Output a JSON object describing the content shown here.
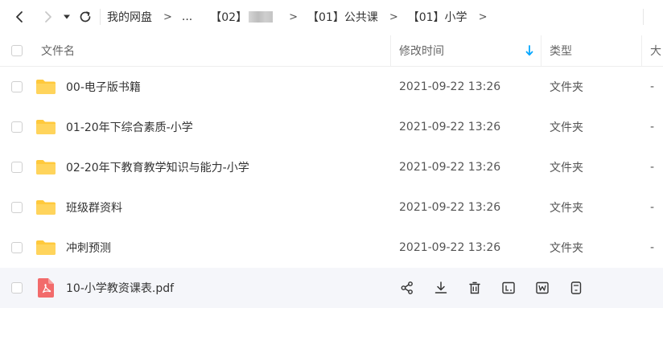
{
  "breadcrumb": {
    "items": [
      "我的网盘",
      "...",
      "【02】",
      "【01】公共课",
      "【01】小学"
    ],
    "separator": ">"
  },
  "table": {
    "columns": {
      "name": "文件名",
      "modified": "修改时间",
      "type": "类型",
      "size": "大"
    },
    "rows": [
      {
        "name": "00-电子版书籍",
        "modified": "2021-09-22 13:26",
        "type": "文件夹",
        "size": "-",
        "icon": "folder-icon"
      },
      {
        "name": "01-20年下综合素质-小学",
        "modified": "2021-09-22 13:26",
        "type": "文件夹",
        "size": "-",
        "icon": "folder-icon"
      },
      {
        "name": "02-20年下教育教学知识与能力-小学",
        "modified": "2021-09-22 13:26",
        "type": "文件夹",
        "size": "-",
        "icon": "folder-icon"
      },
      {
        "name": "班级群资料",
        "modified": "2021-09-22 13:26",
        "type": "文件夹",
        "size": "-",
        "icon": "folder-icon"
      },
      {
        "name": "冲刺预测",
        "modified": "2021-09-22 13:26",
        "type": "文件夹",
        "size": "-",
        "icon": "folder-icon"
      },
      {
        "name": "10-小学教资课表.pdf",
        "icon": "pdf-icon"
      }
    ]
  },
  "colors": {
    "folder": "#FFC93C",
    "pdf": "#F26B6B",
    "sort_arrow": "#06A7FF",
    "hover_row": "#F5F6FA"
  }
}
